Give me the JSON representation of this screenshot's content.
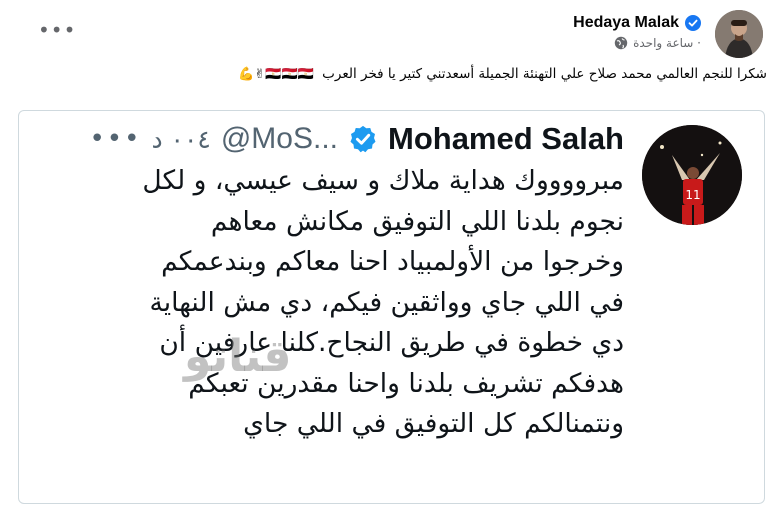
{
  "post": {
    "author": "Hedaya Malak",
    "time_text": "ساعة واحدة ·",
    "text": "شكرا للنجم العالمي محمد صلاح علي التهنئة الجميلة أسعدتني كتير يا فخر العرب",
    "emojis": "🇪🇬🇪🇬🇪🇬✌💪",
    "more_icon": "more-horizontal-icon",
    "globe_icon": "globe-icon",
    "verified_icon": "verified-badge-icon"
  },
  "tweet": {
    "name": "Mohamed Salah",
    "handle": "@MoS...",
    "time": "٠٠٤ د",
    "more_icon": "more-horizontal-icon",
    "verified_icon": "verified-badge-icon",
    "lines": [
      "مبرووووك هداية ملاك و سيف عيسي، و لكل",
      "نجوم بلدنا اللي التوفيق مكانش معاهم",
      "وخرجوا من الأولمبياد احنا معاكم وبندعمكم",
      "في اللي جاي وواثقين فيكم، دي مش النهاية",
      "دي خطوة في طريق النجاح.كلنا عارفين أن",
      "هدفكم تشريف بلدنا واحنا مقدرين تعبكم",
      "ونتمنالكم كل التوفيق في اللي جاي"
    ]
  },
  "watermark": "قناتو",
  "colors": {
    "fb_verified": "#1877f2",
    "tw_verified": "#1d9bf0",
    "secondary_text": "#65676b",
    "tweet_border": "#cfd9de"
  }
}
